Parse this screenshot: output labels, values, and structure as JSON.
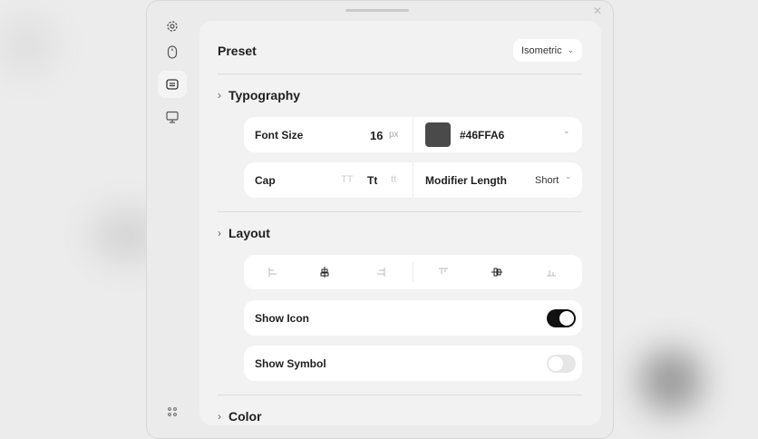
{
  "preset": {
    "title": "Preset",
    "value": "Isometric"
  },
  "typography": {
    "title": "Typography",
    "font_size_label": "Font Size",
    "font_size_value": "16",
    "font_size_unit": "px",
    "color_value": "#46FFA6",
    "swatch_color": "#4a4a4a",
    "cap_label": "Cap",
    "cap_options": [
      "TT",
      "Tt",
      "tt"
    ],
    "modifier_label": "Modifier Length",
    "modifier_value": "Short"
  },
  "layout": {
    "title": "Layout",
    "show_icon_label": "Show Icon",
    "show_icon": true,
    "show_symbol_label": "Show Symbol",
    "show_symbol": false
  },
  "color": {
    "title": "Color"
  }
}
